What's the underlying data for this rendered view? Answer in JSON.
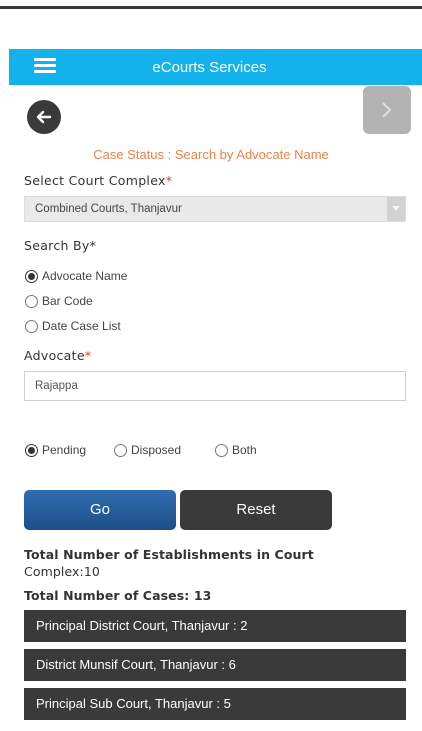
{
  "header": {
    "title": "eCourts Services",
    "color": "#14b2ec"
  },
  "nav": {
    "back_icon": "arrow-left-icon",
    "forward_icon": "chevron-right-icon"
  },
  "page_title": "Case Status : Search by Advocate Name",
  "court_complex": {
    "label": "Select Court Complex",
    "required_mark": "*",
    "selected": "Combined Courts, Thanjavur"
  },
  "search_by": {
    "label": "Search By",
    "required_mark": "*",
    "options": [
      "Advocate Name",
      "Bar Code",
      "Date Case List"
    ],
    "selected": "Advocate Name"
  },
  "advocate": {
    "label": "Advocate",
    "required_mark": "*",
    "value": "Rajappa"
  },
  "status_filter": {
    "options": [
      "Pending",
      "Disposed",
      "Both"
    ],
    "selected": "Pending"
  },
  "buttons": {
    "go": "Go",
    "reset": "Reset"
  },
  "summary": {
    "establishments_line1": "Total Number of Establishments in Court",
    "establishments_line2": "Complex:10",
    "cases": "Total Number of Cases: 13"
  },
  "results": [
    "Principal District Court, Thanjavur : 2",
    "District Munsif Court, Thanjavur : 6",
    "Principal Sub Court, Thanjavur : 5"
  ]
}
